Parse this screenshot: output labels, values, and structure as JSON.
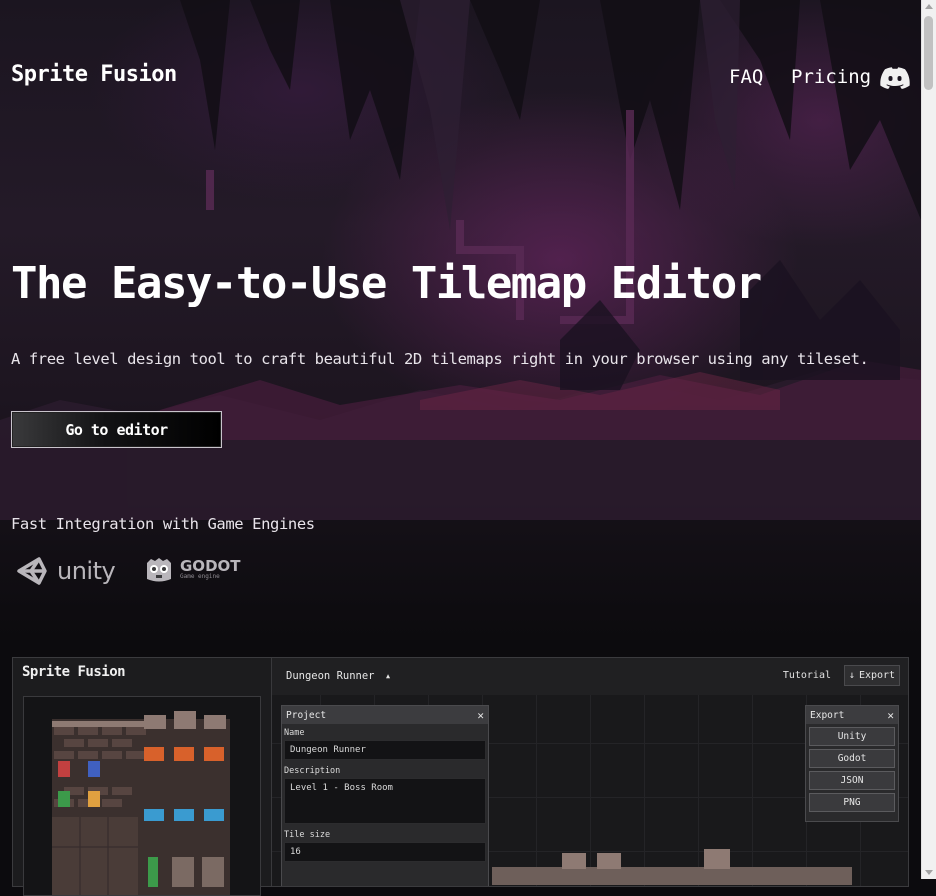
{
  "nav": {
    "brand": "Sprite Fusion",
    "links": [
      {
        "label": "FAQ"
      },
      {
        "label": "Pricing"
      }
    ],
    "discord_icon": "discord-icon"
  },
  "hero": {
    "title": "The Easy-to-Use Tilemap Editor",
    "subtitle": "A free level design tool to craft beautiful 2D tilemaps right in your browser using any tileset.",
    "cta_label": "Go to editor"
  },
  "integrations": {
    "heading": "Fast Integration with Game Engines",
    "engines": [
      {
        "name": "unity",
        "icon": "unity-logo-icon"
      },
      {
        "name": "GODOT",
        "tagline": "Game engine",
        "icon": "godot-logo-icon"
      }
    ]
  },
  "editor_preview": {
    "brand": "Sprite Fusion",
    "project_name": "Dungeon Runner",
    "topbar": {
      "tutorial_label": "Tutorial",
      "export_label": "Export"
    },
    "project_panel": {
      "title": "Project",
      "name_label": "Name",
      "name_value": "Dungeon Runner",
      "description_label": "Description",
      "description_value": "Level 1 - Boss Room",
      "tile_size_label": "Tile size",
      "tile_size_value": "16"
    },
    "export_panel": {
      "title": "Export",
      "options": [
        "Unity",
        "Godot",
        "JSON",
        "PNG"
      ]
    }
  },
  "colors": {
    "background": "#0c0b0e",
    "hero_purple": "#78286e",
    "text": "#f2f0f4"
  }
}
